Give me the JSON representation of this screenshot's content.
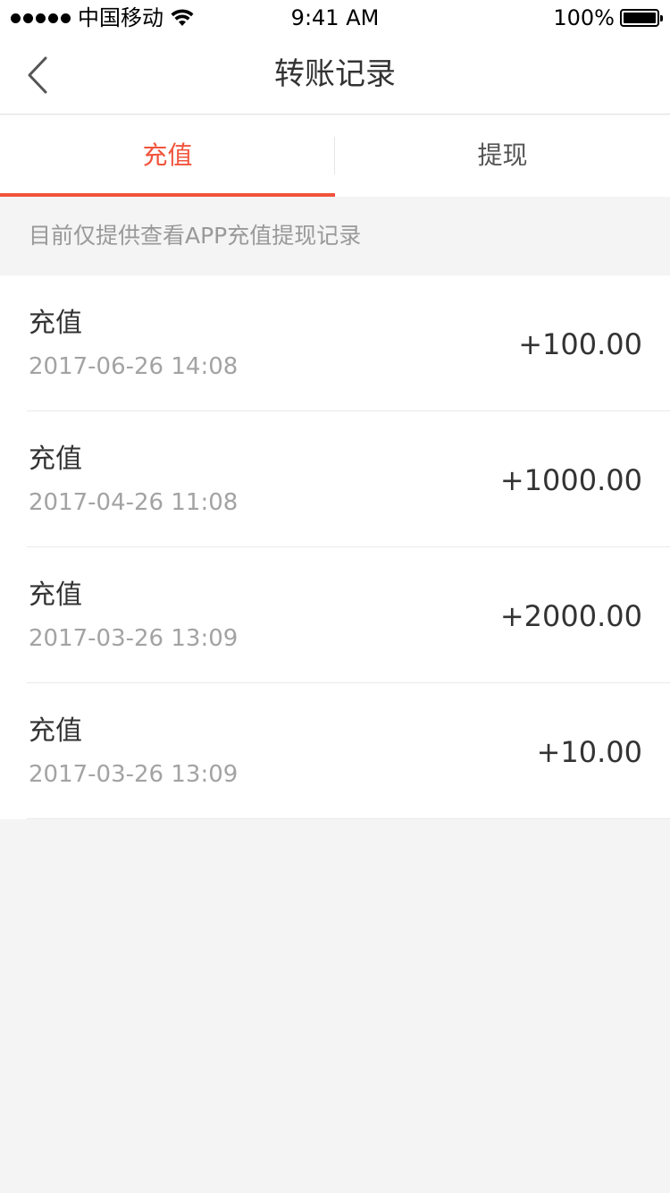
{
  "status_bar": {
    "carrier": "中国移动",
    "time": "9:41 AM",
    "battery": "100%"
  },
  "nav": {
    "title": "转账记录"
  },
  "tabs": [
    {
      "label": "充值",
      "active": true
    },
    {
      "label": "提现",
      "active": false
    }
  ],
  "notice": "目前仅提供查看APP充值提现记录",
  "records": [
    {
      "title": "充值",
      "time": "2017-06-26 14:08",
      "amount": "+100.00"
    },
    {
      "title": "充值",
      "time": "2017-04-26 11:08",
      "amount": "+1000.00"
    },
    {
      "title": "充值",
      "time": "2017-03-26 13:09",
      "amount": "+2000.00"
    },
    {
      "title": "充值",
      "time": "2017-03-26 13:09",
      "amount": "+10.00"
    }
  ],
  "colors": {
    "accent": "#f1533b",
    "background": "#f4f4f4"
  }
}
